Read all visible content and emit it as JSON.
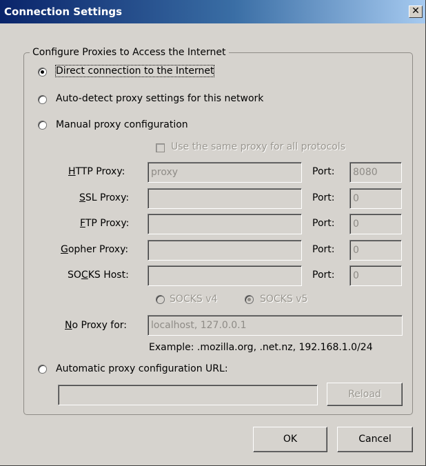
{
  "window": {
    "title": "Connection Settings",
    "close_glyph": "✕"
  },
  "group": {
    "legend": "Configure Proxies to Access the Internet"
  },
  "options": {
    "direct": "Direct connection to the Internet",
    "autodetect": "Auto-detect proxy settings for this network",
    "manual": "Manual proxy configuration",
    "auto_url": "Automatic proxy configuration URL:"
  },
  "selected_option": "direct",
  "same_proxy_label": "Use the same proxy for all protocols",
  "proxies": {
    "http": {
      "label_u": "H",
      "label_rest": "TTP Proxy:",
      "value": "proxy",
      "port_label": "Port:",
      "port": "8080"
    },
    "ssl": {
      "label_u": "S",
      "label_rest": "SL Proxy:",
      "value": "",
      "port_label": "Port:",
      "port": "0"
    },
    "ftp": {
      "label_u": "F",
      "label_rest": "TP Proxy:",
      "value": "",
      "port_label": "Port:",
      "port": "0"
    },
    "gopher": {
      "label_u": "G",
      "label_rest": "opher Proxy:",
      "value": "",
      "port_label": "Port:",
      "port": "0"
    },
    "socks": {
      "label_pre": "SO",
      "label_u": "C",
      "label_rest": "KS Host:",
      "value": "",
      "port_label": "Port:",
      "port": "0"
    }
  },
  "socks_versions": {
    "v4": "SOCKS v4",
    "v5": "SOCKS v5",
    "selected": "v5"
  },
  "no_proxy": {
    "label_u": "N",
    "label_rest": "o Proxy for:",
    "value": "localhost, 127.0.0.1",
    "example": "Example: .mozilla.org, .net.nz, 192.168.1.0/24"
  },
  "auto_url_value": "",
  "buttons": {
    "reload": "Reload",
    "ok": "OK",
    "cancel": "Cancel"
  }
}
